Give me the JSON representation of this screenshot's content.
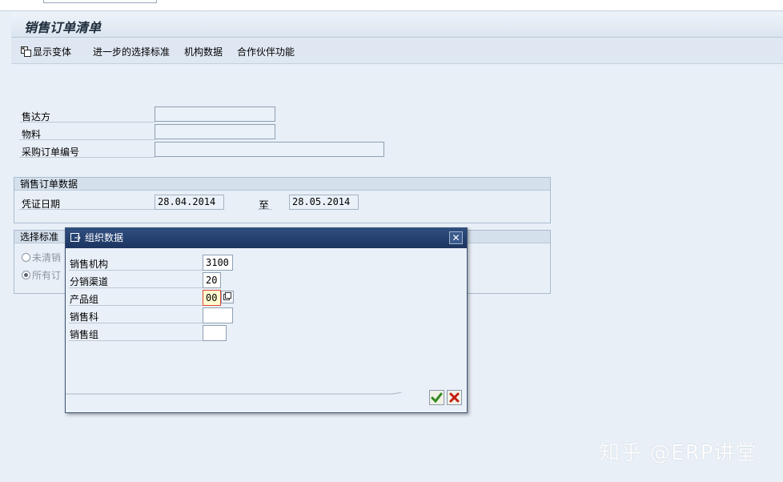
{
  "window": {
    "title": "销售订单清单"
  },
  "toolbar": {
    "display_variant": "显示变体",
    "further_selection": "进一步的选择标准",
    "org_data": "机构数据",
    "partner_functions": "合作伙伴功能"
  },
  "fields": {
    "sold_to": {
      "label": "售达方",
      "value": ""
    },
    "material": {
      "label": "物料",
      "value": ""
    },
    "po_number": {
      "label": "采购订单编号",
      "value": ""
    }
  },
  "so_data": {
    "title": "销售订单数据",
    "doc_date_label": "凭证日期",
    "date_from": "28.04.2014",
    "to_label": "至",
    "date_to": "28.05.2014"
  },
  "selection": {
    "title": "选择标准",
    "open_orders": "未清销",
    "all_orders": "所有订"
  },
  "dialog": {
    "title": "组织数据",
    "close": "✕",
    "rows": [
      {
        "label": "销售机构",
        "value": "3100"
      },
      {
        "label": "分销渠道",
        "value": "20"
      },
      {
        "label": "产品组",
        "value": "00"
      },
      {
        "label": "销售科",
        "value": ""
      },
      {
        "label": "销售组",
        "value": ""
      }
    ]
  },
  "watermark": "知乎 @ERP讲堂",
  "colors": {
    "dialog_title_bg": "#1c3560",
    "screen_bg": "#e8eff7",
    "focus_border": "#dd4433"
  }
}
